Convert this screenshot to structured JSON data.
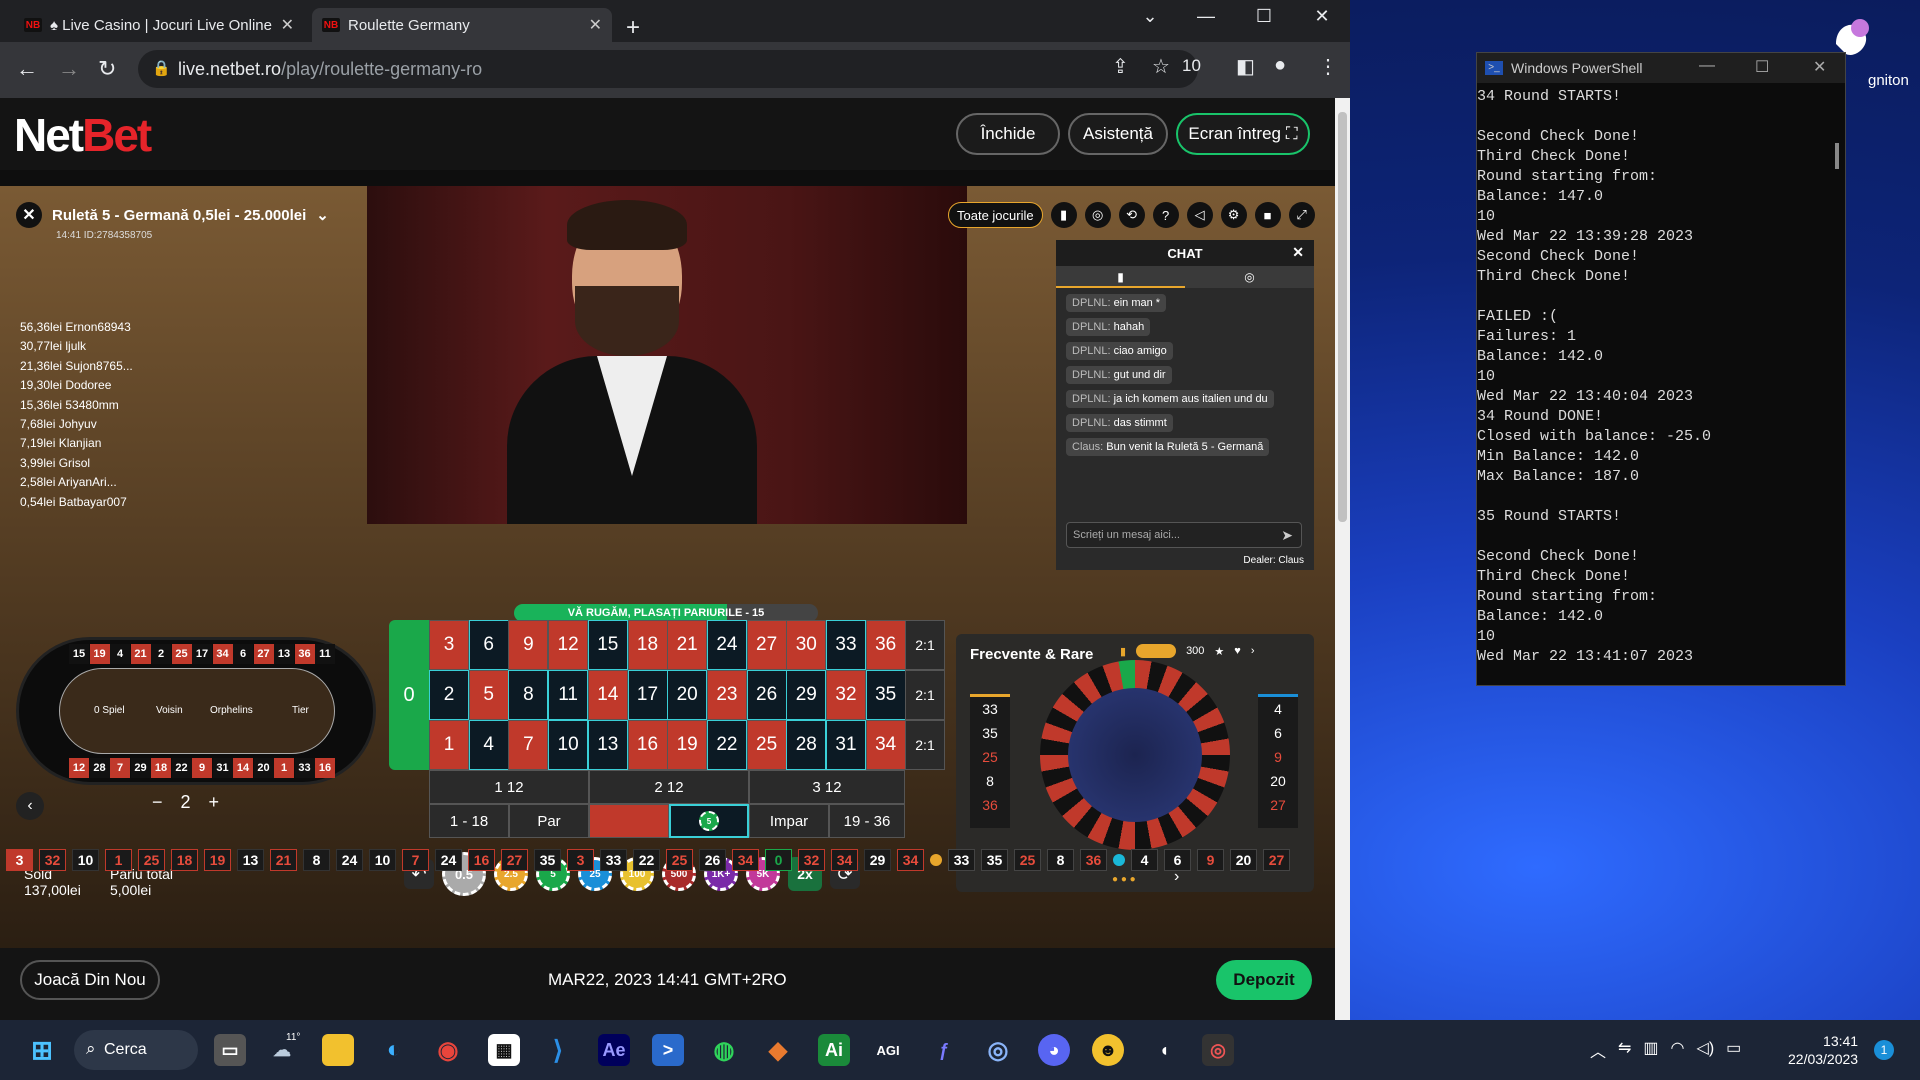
{
  "desktop": {
    "wallpaper_label": "gniton"
  },
  "browser": {
    "tabs": [
      {
        "label": "♠ Live Casino | Jocuri Live Online",
        "favicon": "NB",
        "active": false
      },
      {
        "label": "Roulette Germany",
        "favicon": "NB",
        "active": true
      }
    ],
    "url_host": "live.netbet.ro",
    "url_path": "/play/roulette-germany-ro",
    "extension_count": "10"
  },
  "site": {
    "logo_part1": "Net",
    "logo_part2": "Bet",
    "close_label": "Închide",
    "help_label": "Asistență",
    "fullscreen_label": "Ecran întreg"
  },
  "game": {
    "title": "Ruletă 5 - Germană 0,5lei - 25.000lei",
    "subtitle": "14:41 ID:2784358705",
    "all_games_label": "Toate jocurile",
    "winners": [
      "56,36lei Ernon68943",
      "30,77lei ljulk",
      "21,36lei Sujon8765...",
      "19,30lei Dodoree",
      "15,36lei 53480mm",
      "7,68lei Johyuv",
      "7,19lei Klanjian",
      "3,99lei Grisol",
      "2,58lei AriyanAri...",
      "0,54lei Batbayar007"
    ],
    "banner": "VĂ RUGĂM, PLASAȚI PARIURILE - 15",
    "race_labels": [
      "0 Spiel",
      "Voisin",
      "Orphelins",
      "Tier"
    ],
    "stepper_value": "2",
    "balance_label": "Sold",
    "balance_value": "137,00lei",
    "totalbet_label": "Pariu total",
    "totalbet_value": "5,00lei",
    "replay_label": "Joacă Din Nou",
    "datetime": "MAR22, 2023  14:41 GMT+2RO",
    "deposit_label": "Depozit",
    "chips": [
      "0.5",
      "2.5",
      "5",
      "25",
      "100",
      "500",
      "1K+",
      "5K"
    ],
    "x2_label": "2x"
  },
  "chat": {
    "title": "CHAT",
    "messages": [
      {
        "user": "DPLNL:",
        "text": "ein man *"
      },
      {
        "user": "DPLNL:",
        "text": "hahah"
      },
      {
        "user": "DPLNL:",
        "text": "ciao amigo"
      },
      {
        "user": "DPLNL:",
        "text": "gut und dir"
      },
      {
        "user": "DPLNL:",
        "text": "ja ich komem aus italien und du"
      },
      {
        "user": "DPLNL:",
        "text": "das stimmt"
      },
      {
        "user": "Claus:",
        "text": "Bun venit la Ruletă 5 - Germană"
      }
    ],
    "input_placeholder": "Scrieți un mesaj aici...",
    "dealer": "Dealer: Claus"
  },
  "table": {
    "zero": "0",
    "rows": [
      [
        "3",
        "6",
        "9",
        "12",
        "15",
        "18",
        "21",
        "24",
        "27",
        "30",
        "33",
        "36"
      ],
      [
        "2",
        "5",
        "8",
        "11",
        "14",
        "17",
        "20",
        "23",
        "26",
        "29",
        "32",
        "35"
      ],
      [
        "1",
        "4",
        "7",
        "10",
        "13",
        "16",
        "19",
        "22",
        "25",
        "28",
        "31",
        "34"
      ]
    ],
    "red": [
      "1",
      "3",
      "5",
      "7",
      "9",
      "12",
      "14",
      "16",
      "18",
      "19",
      "21",
      "23",
      "25",
      "27",
      "30",
      "32",
      "34",
      "36"
    ],
    "column_bet": "2:1",
    "dozens": [
      "1 12",
      "2 12",
      "3 12"
    ],
    "even_bets": [
      "1 - 18",
      "Par",
      "",
      "",
      "Impar",
      "19 - 36"
    ]
  },
  "stats": {
    "title": "Frecvente & Rare",
    "count": "300",
    "hot": [
      "33",
      "35",
      "25",
      "8",
      "36"
    ],
    "cold": [
      "4",
      "6",
      "9",
      "20",
      "27"
    ]
  },
  "history": [
    "3",
    "32",
    "10",
    "1",
    "25",
    "18",
    "19",
    "13",
    "21",
    "8",
    "24",
    "10",
    "7",
    "24",
    "16",
    "27",
    "35",
    "3",
    "33",
    "22",
    "25",
    "26",
    "34",
    "0",
    "32",
    "34",
    "29",
    "34"
  ],
  "history_hot": [
    "33",
    "35",
    "25",
    "8",
    "36"
  ],
  "history_cold": [
    "4",
    "6",
    "9",
    "20",
    "27"
  ],
  "powershell": {
    "title": "Windows PowerShell",
    "lines": [
      "34 Round STARTS!",
      "",
      "Second Check Done!",
      "Third Check Done!",
      "Round starting from:",
      "Balance: 147.0",
      "10",
      "Wed Mar 22 13:39:28 2023",
      "Second Check Done!",
      "Third Check Done!",
      "",
      "FAILED :(",
      "Failures: 1",
      "Balance: 142.0",
      "10",
      "Wed Mar 22 13:40:04 2023",
      "34 Round DONE!",
      "Closed with balance: -25.0",
      "Min Balance: 142.0",
      "Max Balance: 187.0",
      "",
      "35 Round STARTS!",
      "",
      "Second Check Done!",
      "Third Check Done!",
      "Round starting from:",
      "Balance: 142.0",
      "10",
      "Wed Mar 22 13:41:07 2023"
    ]
  },
  "taskbar": {
    "search_label": "Cerca",
    "weather_temp": "11°",
    "time": "13:41",
    "date": "22/03/2023",
    "notification_count": "1"
  }
}
